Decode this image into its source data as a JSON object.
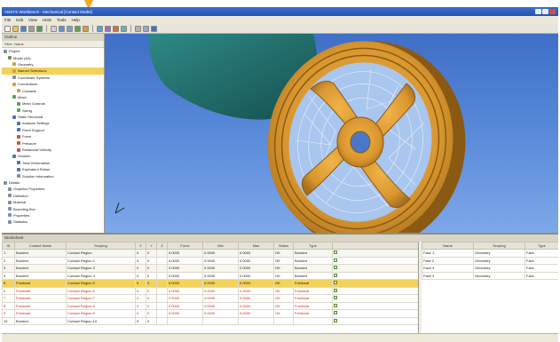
{
  "window": {
    "title": "ANSYS Workbench - Mechanical [Contact Model]"
  },
  "menu": {
    "items": [
      "File",
      "Edit",
      "View",
      "Units",
      "Tools",
      "Help"
    ]
  },
  "toolbar": {
    "icons": [
      "new-icon",
      "open-icon",
      "save-icon",
      "print-icon",
      "undo-icon",
      "select-icon",
      "rotate-icon",
      "pan-icon",
      "zoom-icon",
      "fit-icon",
      "face-icon",
      "edge-icon",
      "vertex-icon",
      "body-icon",
      "iso-icon",
      "wireframe-icon",
      "help-icon"
    ]
  },
  "tree": {
    "header": "Outline",
    "subheader": "Filter: Name",
    "rows": [
      {
        "label": "Project",
        "indent": 0,
        "color": "#7f8fa8"
      },
      {
        "label": "Model (A4)",
        "indent": 1,
        "color": "#6f8f4f"
      },
      {
        "label": "Geometry",
        "indent": 2,
        "color": "#d6a132"
      },
      {
        "label": "Named Selections",
        "indent": 2,
        "color": "#d6a132",
        "selected": true
      },
      {
        "label": "Coordinate Systems",
        "indent": 2,
        "color": "#7f8fa8"
      },
      {
        "label": "Connections",
        "indent": 2,
        "color": "#d6a132"
      },
      {
        "label": "Contacts",
        "indent": 3,
        "color": "#d6a132"
      },
      {
        "label": "Mesh",
        "indent": 2,
        "color": "#5f9f5f"
      },
      {
        "label": "Mesh Controls",
        "indent": 3,
        "color": "#5f9f5f"
      },
      {
        "label": "Sizing",
        "indent": 3,
        "color": "#5f9f5f"
      },
      {
        "label": "Static Structural",
        "indent": 2,
        "color": "#4f6fbf"
      },
      {
        "label": "Analysis Settings",
        "indent": 3,
        "color": "#4f6fbf"
      },
      {
        "label": "Fixed Support",
        "indent": 3,
        "color": "#4f6fbf"
      },
      {
        "label": "Force",
        "indent": 3,
        "color": "#cf4f3f"
      },
      {
        "label": "Pressure",
        "indent": 3,
        "color": "#cf4f3f"
      },
      {
        "label": "Rotational Velocity",
        "indent": 3,
        "color": "#cf4f3f"
      },
      {
        "label": "Solution",
        "indent": 2,
        "color": "#4f6fbf"
      },
      {
        "label": "Total Deformation",
        "indent": 3,
        "color": "#4f6fbf"
      },
      {
        "label": "Equivalent Stress",
        "indent": 3,
        "color": "#4f6fbf"
      },
      {
        "label": "Solution Information",
        "indent": 3,
        "color": "#7f8fa8"
      },
      {
        "label": "Details",
        "indent": 0,
        "color": "#7f8fa8"
      },
      {
        "label": "Graphics Properties",
        "indent": 1,
        "color": "#7f8fa8"
      },
      {
        "label": "Definition",
        "indent": 1,
        "color": "#7f8fa8"
      },
      {
        "label": "Material",
        "indent": 1,
        "color": "#7f8fa8"
      },
      {
        "label": "Bounding Box",
        "indent": 1,
        "color": "#7f8fa8"
      },
      {
        "label": "Properties",
        "indent": 1,
        "color": "#7f8fa8"
      },
      {
        "label": "Statistics",
        "indent": 1,
        "color": "#7f8fa8"
      }
    ]
  },
  "lower": {
    "header": "Worksheet",
    "table_left": {
      "columns": [
        "ID",
        "Contact Name",
        "Scoping",
        "X",
        "Y",
        "Z",
        "Force",
        "Min",
        "Max",
        "Status",
        "Type",
        ""
      ],
      "rows": [
        {
          "cells": [
            "1",
            "Bonded",
            "Contact Region",
            "0",
            "0",
            "",
            "0.0000",
            "0.0000",
            "0.0000",
            "OK",
            "Bonded"
          ],
          "style": "alt"
        },
        {
          "cells": [
            "2",
            "Bonded",
            "Contact Region 2",
            "0",
            "0",
            "",
            "0.0000",
            "0.0000",
            "0.0000",
            "OK",
            "Bonded"
          ],
          "style": ""
        },
        {
          "cells": [
            "3",
            "Bonded",
            "Contact Region 3",
            "0",
            "0",
            "",
            "0.0000",
            "0.0000",
            "0.0000",
            "OK",
            "Bonded"
          ],
          "style": "alt"
        },
        {
          "cells": [
            "4",
            "Bonded",
            "Contact Region 4",
            "0",
            "0",
            "",
            "0.0000",
            "0.0000",
            "0.0000",
            "OK",
            "Bonded"
          ],
          "style": ""
        },
        {
          "cells": [
            "5",
            "Frictional",
            "Contact Region 5",
            "0",
            "0",
            "",
            "0.0000",
            "0.0000",
            "0.0000",
            "OK",
            "Frictional"
          ],
          "style": "sel"
        },
        {
          "cells": [
            "6",
            "Frictional",
            "Contact Region 6",
            "0",
            "0",
            "",
            "0.0000",
            "0.0000",
            "0.0000",
            "OK",
            "Frictional"
          ],
          "style": "red"
        },
        {
          "cells": [
            "7",
            "Frictional",
            "Contact Region 7",
            "0",
            "0",
            "",
            "0.0000",
            "0.0000",
            "0.0000",
            "OK",
            "Frictional"
          ],
          "style": "red"
        },
        {
          "cells": [
            "8",
            "Frictional",
            "Contact Region 8",
            "0",
            "0",
            "",
            "0.0000",
            "0.0000",
            "0.0000",
            "OK",
            "Frictional"
          ],
          "style": "red"
        },
        {
          "cells": [
            "9",
            "Frictional",
            "Contact Region 9",
            "0",
            "0",
            "",
            "0.0000",
            "0.0000",
            "0.0000",
            "OK",
            "Frictional"
          ],
          "style": "red"
        },
        {
          "cells": [
            "10",
            "Bonded",
            "Contact Region 10",
            "0",
            "0",
            "",
            "",
            "",
            "",
            "",
            ""
          ],
          "style": ""
        }
      ]
    },
    "table_right": {
      "columns": [
        "Name",
        "Scoping",
        "Type"
      ],
      "rows": [
        {
          "cells": [
            "Face 1",
            "Geometry",
            "Face"
          ]
        },
        {
          "cells": [
            "Face 2",
            "Geometry",
            "Face"
          ]
        },
        {
          "cells": [
            "Face 3",
            "Geometry",
            "Face"
          ]
        },
        {
          "cells": [
            "Face 4",
            "Geometry",
            "Face"
          ]
        }
      ]
    }
  },
  "colors": {
    "viewport_top": "#3f6fc6",
    "wheel": "#d9962e",
    "wheel_dark": "#8a5a14",
    "hub_part": "#1f6b6b",
    "selection": "#f3d25a",
    "warning_text": "#cf2a1a"
  }
}
